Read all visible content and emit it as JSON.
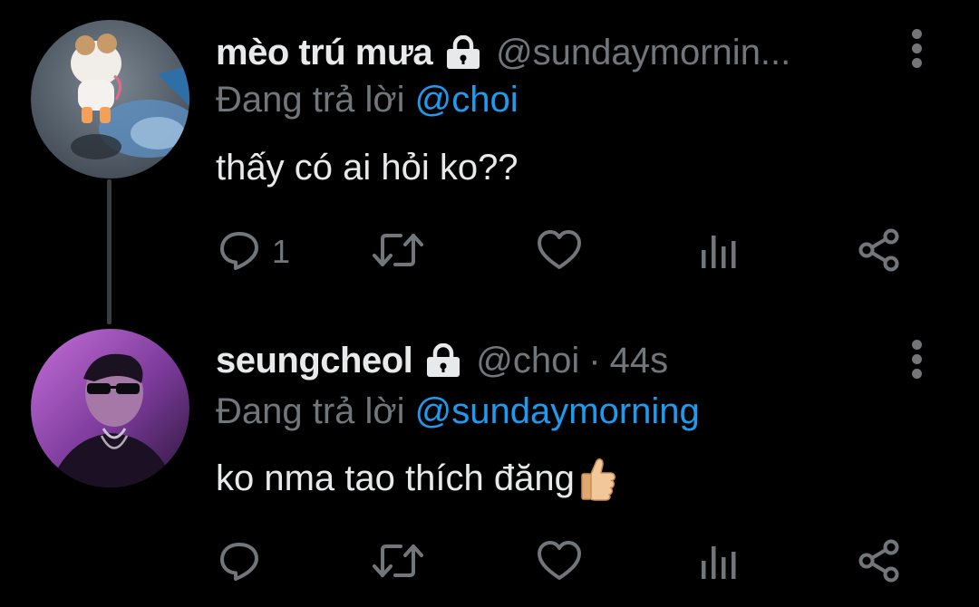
{
  "tweets": [
    {
      "display_name": "mèo trú mưa",
      "locked": true,
      "handle": "@sundaymornin...",
      "replying_prefix": "Đang trả lời",
      "replying_to": "@choi",
      "text": "thấy có ai hỏi ko??",
      "actions": {
        "reply_count": "1",
        "retweet_count": "",
        "like_count": "",
        "view_count": ""
      }
    },
    {
      "display_name": "seungcheol",
      "locked": true,
      "handle": "@choi",
      "separator": "·",
      "time": "44s",
      "replying_prefix": "Đang trả lời",
      "replying_to": "@sundaymorning",
      "text": "ko nma tao thích đăng",
      "emoji": "thumbs-up",
      "actions": {
        "reply_count": "",
        "retweet_count": "",
        "like_count": "",
        "view_count": ""
      }
    }
  ],
  "colors": {
    "background": "#000000",
    "text_primary": "#e7e9ea",
    "text_secondary": "#71767b",
    "accent": "#1d9bf0",
    "thread_line": "#3a3d40"
  },
  "icons": [
    "lock-icon",
    "more-icon",
    "reply-icon",
    "retweet-icon",
    "like-icon",
    "views-icon",
    "share-icon",
    "thumbs-up-emoji"
  ]
}
